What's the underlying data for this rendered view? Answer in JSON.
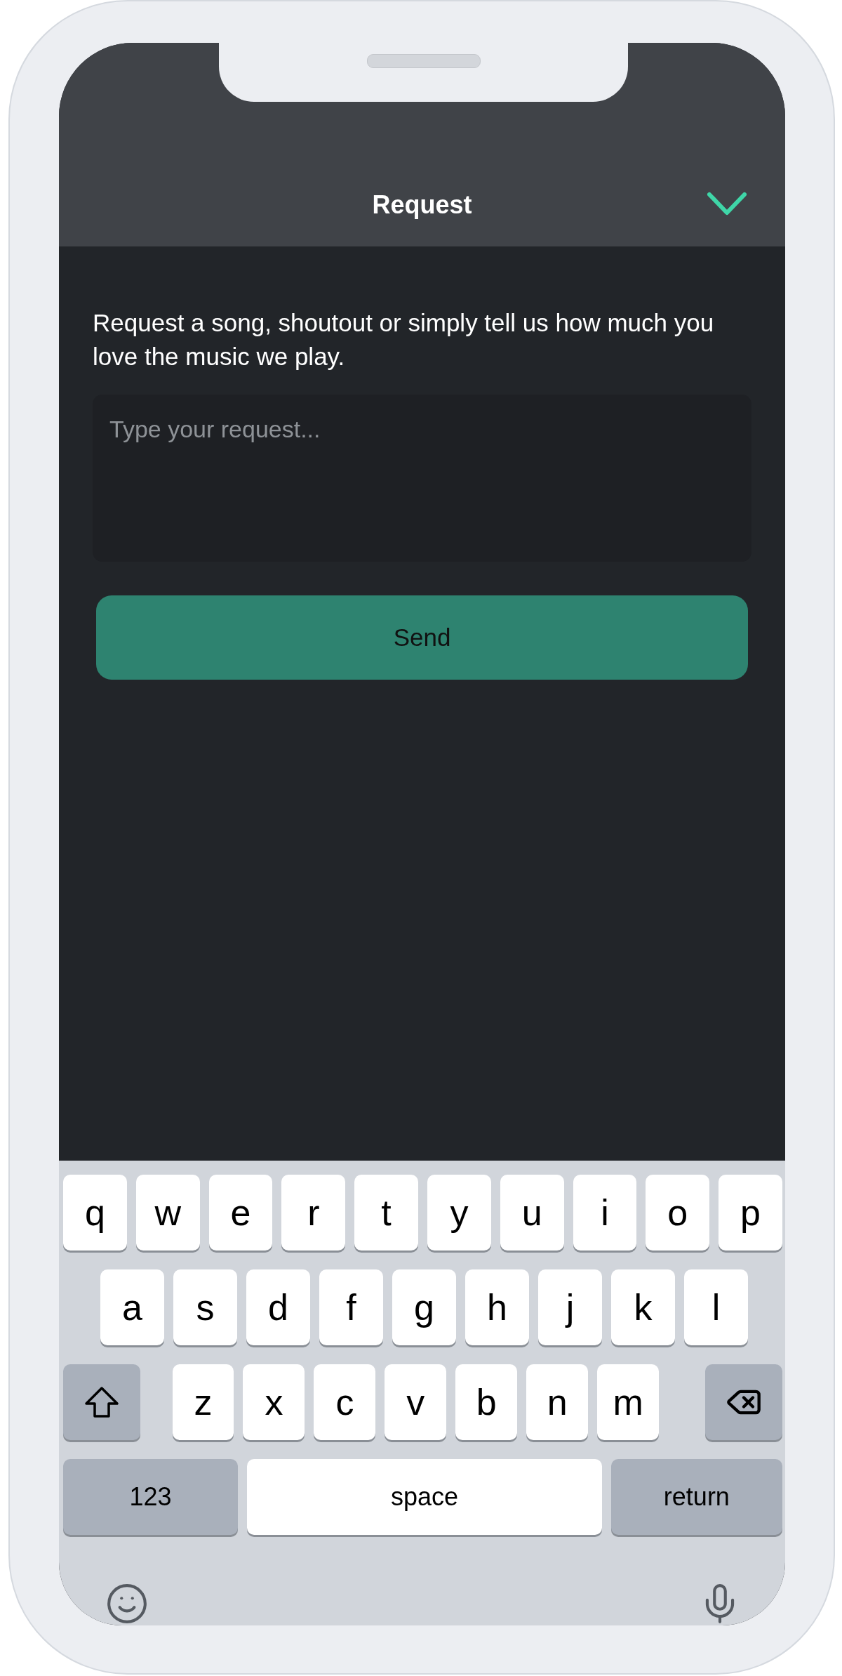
{
  "header": {
    "title": "Request"
  },
  "description": "Request a song, shoutout or simply tell us how much you love the music we play.",
  "request_field": {
    "placeholder": "Type your request..."
  },
  "send_button": {
    "label": "Send"
  },
  "keyboard": {
    "rows": [
      {
        "keys": [
          {
            "kind": "letter",
            "label": "q"
          },
          {
            "kind": "letter",
            "label": "w"
          },
          {
            "kind": "letter",
            "label": "e"
          },
          {
            "kind": "letter",
            "label": "r"
          },
          {
            "kind": "letter",
            "label": "t"
          },
          {
            "kind": "letter",
            "label": "y"
          },
          {
            "kind": "letter",
            "label": "u"
          },
          {
            "kind": "letter",
            "label": "i"
          },
          {
            "kind": "letter",
            "label": "o"
          },
          {
            "kind": "letter",
            "label": "p"
          }
        ]
      },
      {
        "keys": [
          {
            "kind": "letter",
            "label": "a"
          },
          {
            "kind": "letter",
            "label": "s"
          },
          {
            "kind": "letter",
            "label": "d"
          },
          {
            "kind": "letter",
            "label": "f"
          },
          {
            "kind": "letter",
            "label": "g"
          },
          {
            "kind": "letter",
            "label": "h"
          },
          {
            "kind": "letter",
            "label": "j"
          },
          {
            "kind": "letter",
            "label": "k"
          },
          {
            "kind": "letter",
            "label": "l"
          }
        ]
      },
      {
        "keys": [
          {
            "kind": "shift"
          },
          {
            "kind": "letter",
            "label": "z"
          },
          {
            "kind": "letter",
            "label": "x"
          },
          {
            "kind": "letter",
            "label": "c"
          },
          {
            "kind": "letter",
            "label": "v"
          },
          {
            "kind": "letter",
            "label": "b"
          },
          {
            "kind": "letter",
            "label": "n"
          },
          {
            "kind": "letter",
            "label": "m"
          },
          {
            "kind": "delete"
          }
        ]
      },
      {
        "keys": [
          {
            "kind": "numbers",
            "label": "123"
          },
          {
            "kind": "space",
            "label": "space"
          },
          {
            "kind": "return",
            "label": "return"
          }
        ]
      }
    ],
    "bottom": [
      {
        "kind": "emoji"
      },
      {
        "kind": "mic"
      }
    ]
  }
}
